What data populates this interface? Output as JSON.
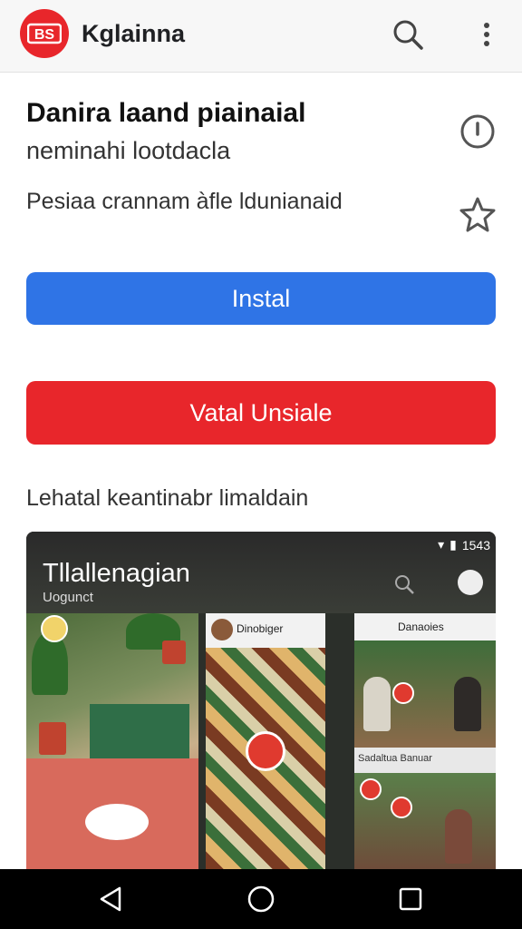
{
  "app_bar": {
    "brand": "Kglainna",
    "logo_text": "BS",
    "logo_color": "#e8262b",
    "icons": [
      "search-icon",
      "more-vert-icon"
    ]
  },
  "app": {
    "title": "Danira laand piainaial",
    "subtitle": "neminahi lootdacla",
    "description": "Pesiaa crannam àfle ldunianaid"
  },
  "buttons": {
    "install_label": "Instal",
    "install_color": "#2f74e6",
    "uninstall_label": "Vatal Unsiale",
    "uninstall_color": "#e8262b"
  },
  "section": {
    "label": "Lehatal keantinabr limaldain"
  },
  "gallery": {
    "status_time": "1543",
    "title": "Tllallenagian",
    "subtitle": "Uogunct",
    "shot2_title": "Dinobiger",
    "shot3_title": "Danaoies",
    "shot3_strip": "Sadaltua Banuar"
  },
  "nav": {
    "icons": [
      "back-icon",
      "home-icon",
      "recents-icon"
    ]
  }
}
